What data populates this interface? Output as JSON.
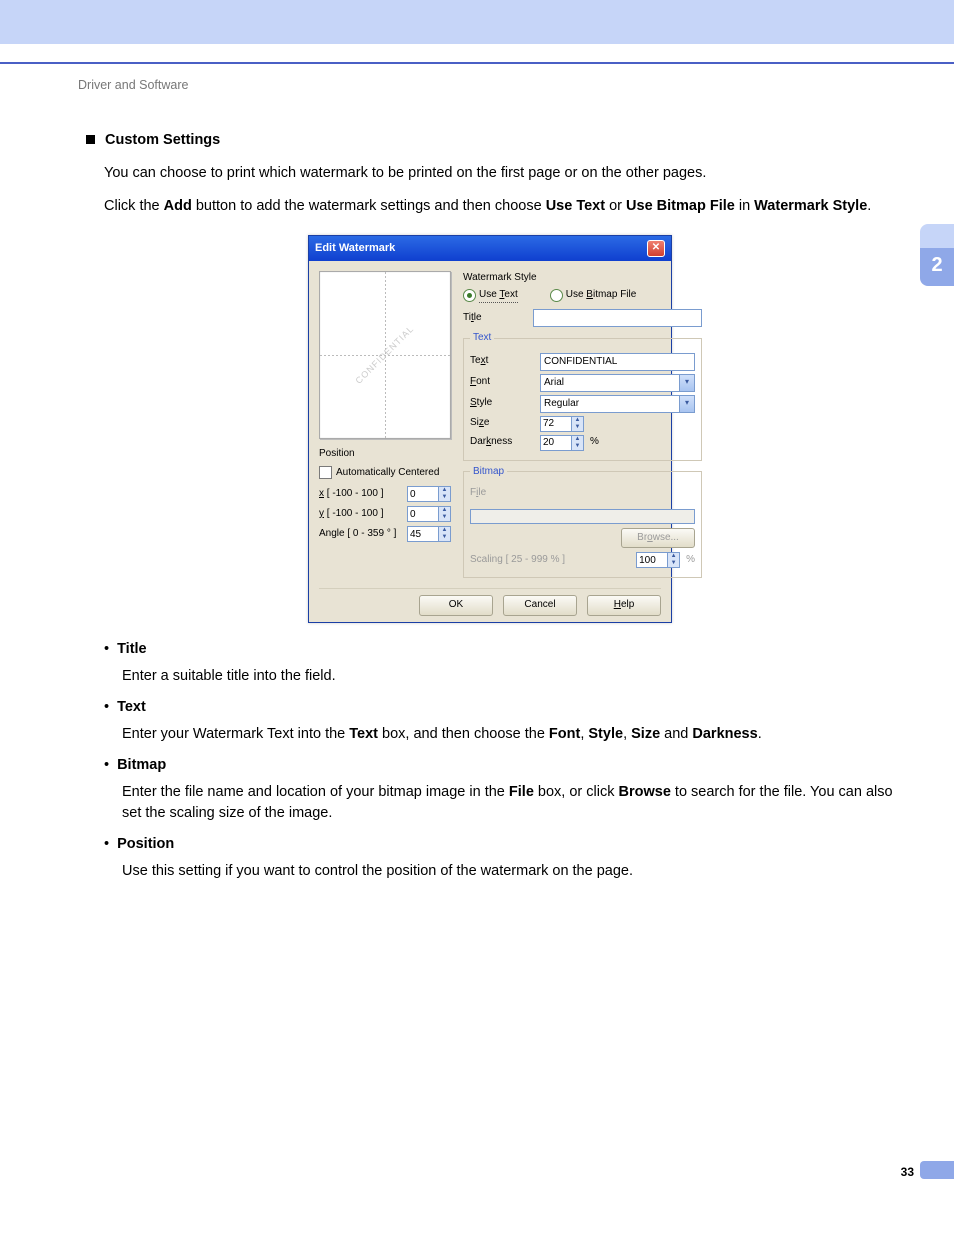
{
  "header": {
    "label": "Driver and Software"
  },
  "chapter_tab": "2",
  "page_number": "33",
  "section": {
    "title": "Custom Settings",
    "intro": "You can choose to print which watermark to be printed on the first page or on the other pages.",
    "p2_a": "Click the ",
    "p2_add": "Add",
    "p2_b": " button to add the watermark settings and then choose ",
    "p2_usetext": "Use Text",
    "p2_or": " or ",
    "p2_usebmp": "Use Bitmap File",
    "p2_c": " in ",
    "p2_style": "Watermark Style",
    "p2_d": "."
  },
  "dialog": {
    "title": "Edit Watermark",
    "close": "✕",
    "preview_text": "CONFIDENTIAL",
    "position": {
      "label": "Position",
      "auto_center": "Automatically Centered",
      "x_label_pre": "x",
      "x_label": " [ -100 - 100 ]",
      "y_label_pre": "y",
      "y_label": " [ -100 - 100 ]",
      "angle_label": "Angle [ 0 - 359 ° ]",
      "x": "0",
      "y": "0",
      "angle": "45"
    },
    "style": {
      "label": "Watermark Style",
      "use_text_pre": "Use ",
      "use_text_u": "T",
      "use_text_post": "ext",
      "use_bmp_pre": "Use ",
      "use_bmp_u": "B",
      "use_bmp_post": "itmap File"
    },
    "title_field": {
      "label_pre": "Ti",
      "label_u": "t",
      "label_post": "le",
      "value": ""
    },
    "text_group": {
      "legend": "Text",
      "text_label_pre": "Te",
      "text_label_u": "x",
      "text_label_post": "t",
      "text_value": "CONFIDENTIAL",
      "font_label_u": "F",
      "font_label_post": "ont",
      "font_value": "Arial",
      "style_label_u": "S",
      "style_label_post": "tyle",
      "style_value": "Regular",
      "size_label_pre": "Si",
      "size_label_u": "z",
      "size_label_post": "e",
      "size_value": "72",
      "dark_label_pre": "Dar",
      "dark_label_u": "k",
      "dark_label_post": "ness",
      "dark_value": "20",
      "dark_unit": "%"
    },
    "bitmap_group": {
      "legend": "Bitmap",
      "file_label_pre": "F",
      "file_label_u": "i",
      "file_label_post": "le",
      "file_value": "",
      "browse_pre": "Br",
      "browse_u": "o",
      "browse_post": "wse...",
      "scaling_label": "Scaling [ 25 - 999 % ]",
      "scaling_value": "100",
      "scaling_unit": "%"
    },
    "buttons": {
      "ok": "OK",
      "cancel": "Cancel",
      "help_u": "H",
      "help_post": "elp"
    }
  },
  "descriptions": {
    "title": {
      "head": "Title",
      "body": "Enter a suitable title into the field."
    },
    "text": {
      "head": "Text",
      "b1": "Enter your Watermark Text into the ",
      "b_text": "Text",
      "b2": " box, and then choose the ",
      "b_font": "Font",
      "c1": ", ",
      "b_style": "Style",
      "c2": ", ",
      "b_size": "Size",
      "c3": " and ",
      "b_dark": "Darkness",
      "c4": "."
    },
    "bitmap": {
      "head": "Bitmap",
      "b1": "Enter the file name and location of your bitmap image in the ",
      "b_file": "File",
      "b2": " box, or click ",
      "b_browse": "Browse",
      "b3": " to search for the file. You can also set the scaling size of the image."
    },
    "position": {
      "head": "Position",
      "body": "Use this setting if you want to control the position of the watermark on the page."
    }
  }
}
